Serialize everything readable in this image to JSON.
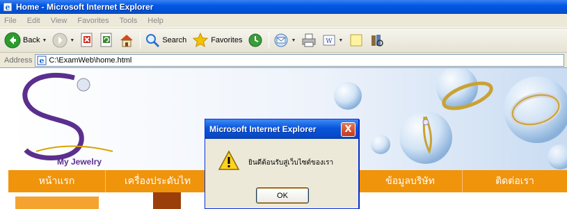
{
  "window": {
    "title": "Home - Microsoft Internet Explorer"
  },
  "menu": {
    "items": [
      "File",
      "Edit",
      "View",
      "Favorites",
      "Tools",
      "Help"
    ]
  },
  "toolbar": {
    "back_label": "Back",
    "search_label": "Search",
    "favorites_label": "Favorites"
  },
  "address": {
    "label": "Address",
    "value": "C:\\ExamWeb\\home.html"
  },
  "page": {
    "logo_subtitle": "My Jewelry",
    "nav": [
      "หน้าแรก",
      "เครื่องประดับไท",
      "",
      "ข้อมูลบริษัท",
      "ติดต่อเรา"
    ]
  },
  "dialog": {
    "title": "Microsoft Internet Explorer",
    "message": "ยินดีต้อนรับสู่เว็บไซต์ของเรา",
    "ok_label": "OK",
    "close_glyph": "X"
  },
  "colors": {
    "nav_bg": "#f0940c",
    "titlebar_blue": "#0058e6",
    "chrome_bg": "#ece9d8"
  }
}
